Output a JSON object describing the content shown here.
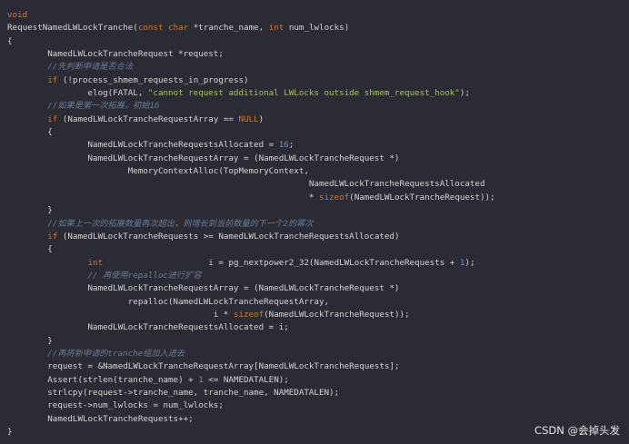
{
  "watermark": "CSDN @会掉头发",
  "code": {
    "l1": "void",
    "l2_name": "RequestNamedLWLockTranche(",
    "l2_const": "const",
    "l2_char": "char",
    "l2_mid": " *tranche_name, ",
    "l2_int": "int",
    "l2_end": " num_lwlocks)",
    "l3": "{",
    "l4": "        NamedLWLockTrancheRequest *request;",
    "l5": "        //先判断申请是否合法",
    "l6_if": "if",
    "l6_rest": " (!process_shmem_requests_in_progress)",
    "l7_pre": "                elog(FATAL, ",
    "l7_str": "\"cannot request additional LWLocks outside shmem_request_hook\"",
    "l7_end": ");",
    "l8": "        //如果是第一次拓展，初始16",
    "l9_if": "if",
    "l9_mid": " (NamedLWLockTrancheRequestArray == ",
    "l9_null": "NULL",
    "l9_end": ")",
    "l10": "        {",
    "l11_pre": "                NamedLWLockTrancheRequestsAllocated = ",
    "l11_num": "16",
    "l11_end": ";",
    "l12": "                NamedLWLockTrancheRequestArray = (NamedLWLockTrancheRequest *)",
    "l13": "                        MemoryContextAlloc(TopMemoryContext,",
    "l14": "                                                            NamedLWLockTrancheRequestsAllocated",
    "l15_pre": "                                                            * ",
    "l15_kw": "sizeof",
    "l15_end": "(NamedLWLockTrancheRequest));",
    "l16": "        }",
    "l17": "        //如果上一次的拓展数量再次超出，则增长到当前数量的下一个2的幂次",
    "l18_if": "if",
    "l18_rest": " (NamedLWLockTrancheRequests >= NamedLWLockTrancheRequestsAllocated)",
    "l19": "        {",
    "l20_int": "int",
    "l20_mid": "                     i = pg_nextpower2_32(NamedLWLockTrancheRequests + ",
    "l20_num": "1",
    "l20_end": ");",
    "l21": "                // 再使用repalloc进行扩容",
    "l22": "                NamedLWLockTrancheRequestArray = (NamedLWLockTrancheRequest *)",
    "l23": "                        repalloc(NamedLWLockTrancheRequestArray,",
    "l24_pre": "                                         i * ",
    "l24_kw": "sizeof",
    "l24_end": "(NamedLWLockTrancheRequest));",
    "l25": "                NamedLWLockTrancheRequestsAllocated = i;",
    "l26": "        }",
    "l27": "        //再将新申请的tranche组加入进去",
    "l28": "        request = &NamedLWLockTrancheRequestArray[NamedLWLockTrancheRequests];",
    "l29_pre": "        Assert(strlen(tranche_name) + ",
    "l29_num": "1",
    "l29_end": " <= NAMEDATALEN);",
    "l30": "        strlcpy(request->tranche_name, tranche_name, NAMEDATALEN);",
    "l31": "        request->num_lwlocks = num_lwlocks;",
    "l32": "        NamedLWLockTrancheRequests++;",
    "l33": "}"
  }
}
